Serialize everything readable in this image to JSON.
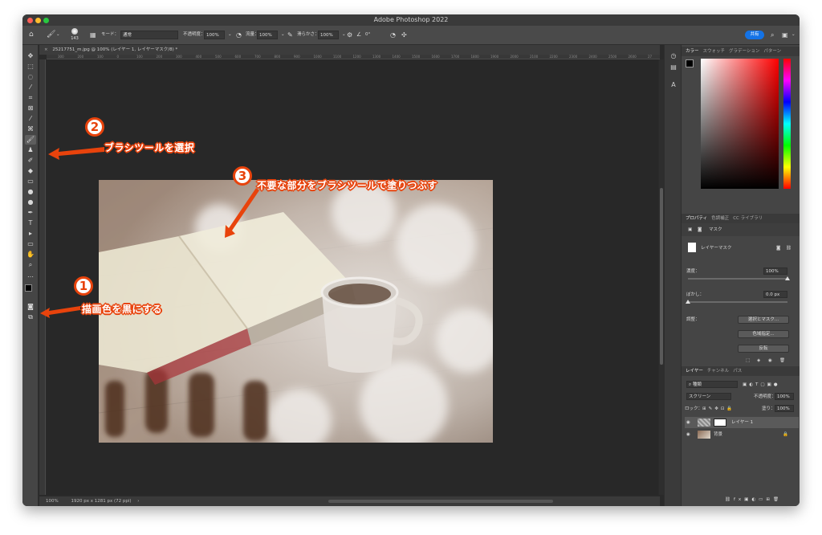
{
  "window": {
    "title": "Adobe Photoshop 2022"
  },
  "options_bar": {
    "brush_size": "143",
    "mode_label": "モード：",
    "mode_value": "通常",
    "opacity_label": "不透明度：",
    "opacity_value": "100%",
    "flow_label": "流量：",
    "flow_value": "100%",
    "smoothing_label": "滑らかさ：",
    "smoothing_value": "100%",
    "angle_value": "0°",
    "share_label": "共有"
  },
  "document": {
    "tab_title": "25217751_m.jpg @ 100% (レイヤー 1, レイヤーマスク/8) *",
    "zoom": "100%",
    "info": "1920 px x 1281 px (72 ppi)"
  },
  "ruler_ticks": [
    "300",
    "200",
    "100",
    "0",
    "100",
    "200",
    "300",
    "400",
    "500",
    "600",
    "700",
    "800",
    "900",
    "1000",
    "1100",
    "1200",
    "1300",
    "1400",
    "1500",
    "1600",
    "1700",
    "1800",
    "1900",
    "2000",
    "2100",
    "2200",
    "2300",
    "2400",
    "2500",
    "2600",
    "27"
  ],
  "color_panel": {
    "tabs": [
      "カラー",
      "スウォッチ",
      "グラデーション",
      "パターン"
    ]
  },
  "properties_panel": {
    "tabs": [
      "プロパティ",
      "色調補正",
      "CC ライブラリ"
    ],
    "mask_label": "マスク",
    "layer_mask_label": "レイヤーマスク",
    "density_label": "濃度：",
    "density_value": "100%",
    "density_fraction": 1.0,
    "feather_label": "ぼかし：",
    "feather_value": "0.0 px",
    "feather_fraction": 0.0,
    "adjust_label": "調整：",
    "select_mask_button": "選択とマスク...",
    "color_range_button": "色域指定...",
    "invert_button": "反転"
  },
  "layers_panel": {
    "tabs": [
      "レイヤー",
      "チャンネル",
      "パス"
    ],
    "filter_kind": "種類",
    "blend_mode": "スクリーン",
    "opacity_label": "不透明度：",
    "opacity_value": "100%",
    "lock_label": "ロック：",
    "fill_label": "塗り：",
    "fill_value": "100%",
    "layers": [
      {
        "name": "レイヤー 1"
      },
      {
        "name": "背景"
      }
    ]
  },
  "annotations": {
    "step1_number": "1",
    "step1_text": "描画色を黒にする",
    "step2_number": "2",
    "step2_text": "ブラシツールを選択",
    "step3_number": "3",
    "step3_text": "不要な部分をブラシツールで塗りつぶす",
    "color": "#e8430c"
  }
}
